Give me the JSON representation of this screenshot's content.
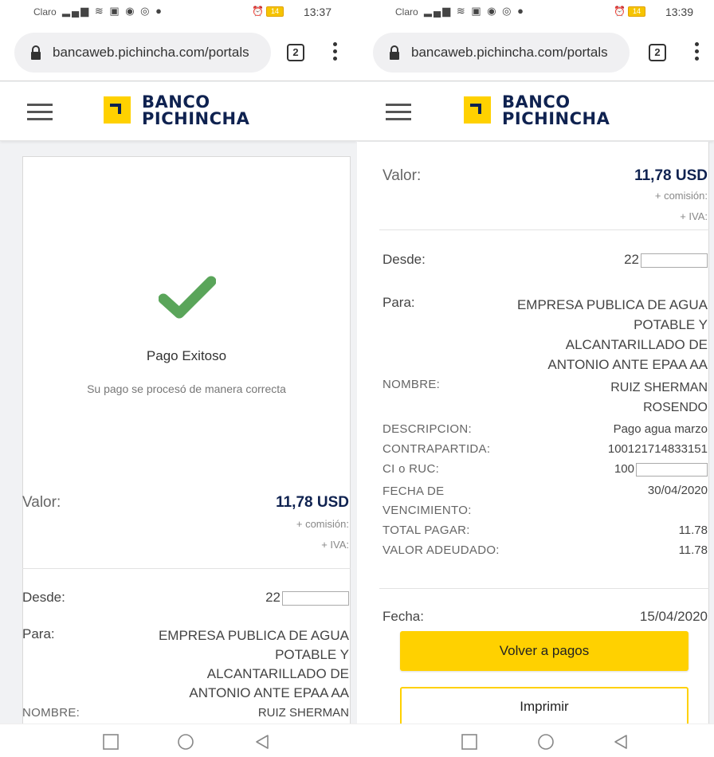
{
  "status_left": {
    "carrier": "Claro",
    "clock": "13:37",
    "battery": "14"
  },
  "status_right": {
    "carrier": "Claro",
    "clock": "13:39",
    "battery": "14"
  },
  "browser": {
    "url": "bancaweb.pichincha.com/portals",
    "tab_count": "2"
  },
  "brand": {
    "line1": "BANCO",
    "line2": "PICHINCHA",
    "logo_color": "#ffd100",
    "text_color": "#0f2250"
  },
  "success": {
    "title": "Pago Exitoso",
    "subtitle": "Su pago se procesó de manera correcta",
    "check_color": "#5aa55a"
  },
  "payment": {
    "valor_label": "Valor:",
    "valor_amount": "11,78 USD",
    "comision": "+ comisión:",
    "iva": "+ IVA:",
    "desde_label": "Desde:",
    "desde_value": "22",
    "para_label": "Para:",
    "para_lines": [
      "EMPRESA PUBLICA DE AGUA",
      "POTABLE Y",
      "ALCANTARILLADO DE",
      "ANTONIO ANTE EPAA AA"
    ],
    "nombre_label": "NOMBRE:",
    "nombre_lines": [
      "RUIZ SHERMAN",
      "ROSENDO"
    ],
    "descripcion_label": "DESCRIPCION:",
    "descripcion_value": "Pago agua marzo",
    "contrapartida_label": "CONTRAPARTIDA:",
    "contrapartida_value": "100121714833151",
    "ci_label": "CI o RUC:",
    "ci_value": "100",
    "fecha_venc_label_1": "FECHA DE",
    "fecha_venc_label_2": "VENCIMIENTO:",
    "fecha_venc_value": "30/04/2020",
    "total_label": "TOTAL PAGAR:",
    "total_value": "11.78",
    "adeudado_label": "VALOR ADEUDADO:",
    "adeudado_value": "11.78",
    "fecha_label": "Fecha:",
    "fecha_value": "15/04/2020",
    "nombre_cut_label": "NOMBRE:",
    "nombre_cut_value": "RUIZ SHERMAN"
  },
  "buttons": {
    "back": "Volver a pagos",
    "print": "Imprimir"
  }
}
